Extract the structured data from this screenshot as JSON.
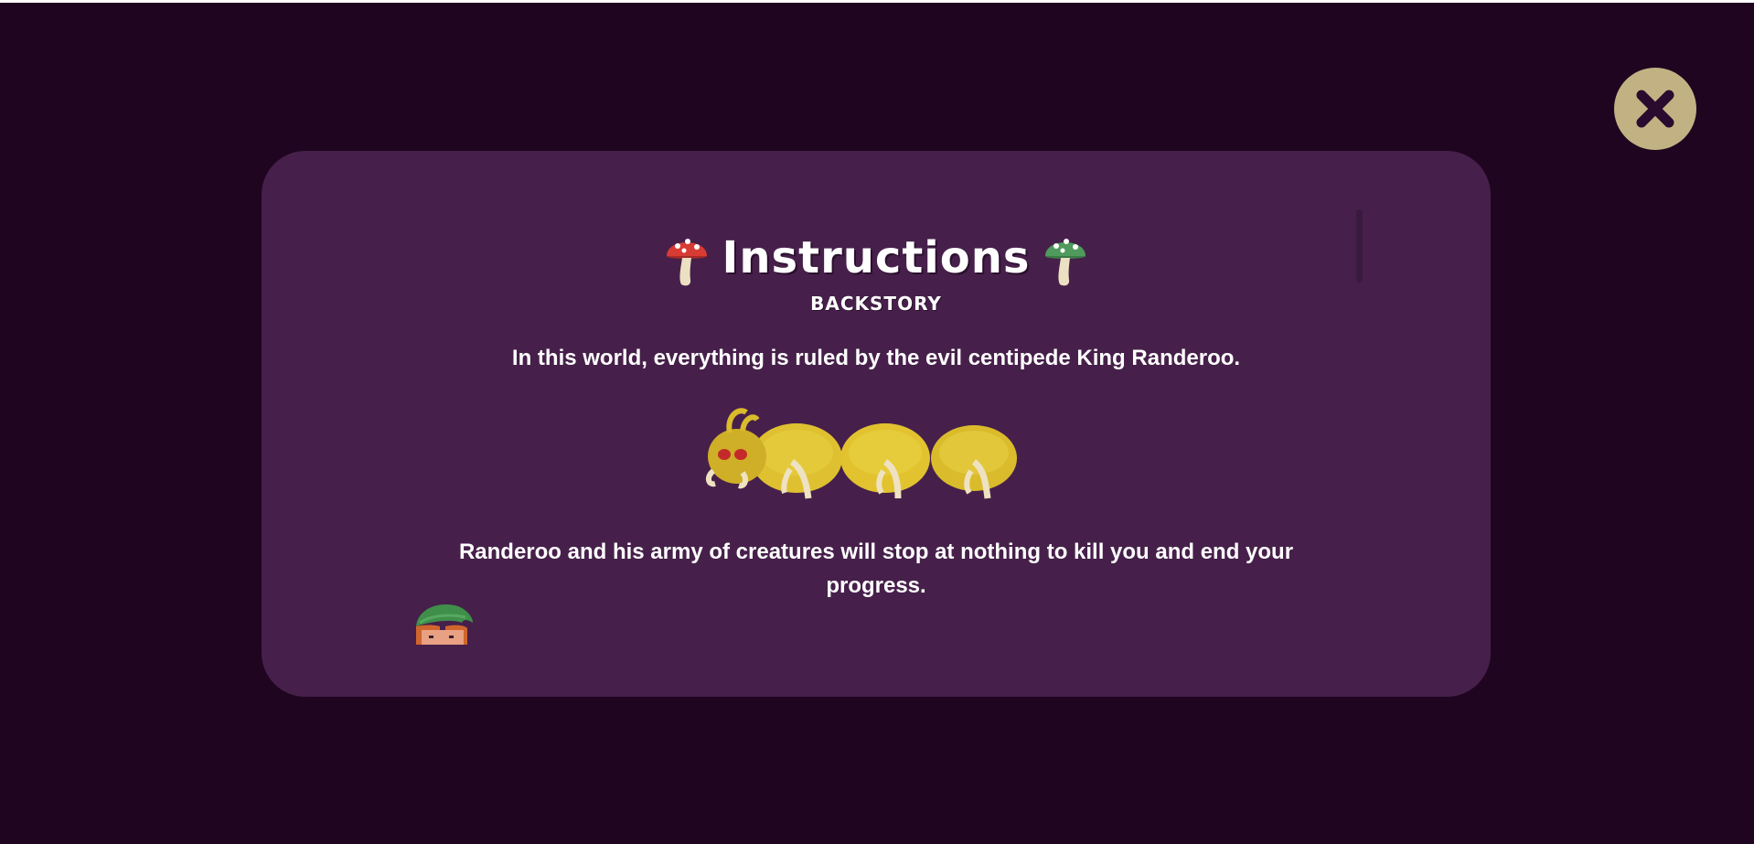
{
  "modal": {
    "title": "Instructions",
    "subtitle": "BACKSTORY",
    "paragraph_1": "In this world, everything is ruled by the evil centipede King Randeroo.",
    "paragraph_2": "Randeroo and his army of creatures will stop at nothing to kill you and end your progress."
  },
  "icons": {
    "left_title_icon": "red-mushroom-icon",
    "right_title_icon": "green-mushroom-icon",
    "close": "close-icon",
    "centipede_image": "yellow-centipede-king",
    "elf_image": "elf-with-green-hat"
  },
  "colors": {
    "background": "#1f0520",
    "modal": "#46204a",
    "close_button": "#c2b283",
    "text": "#ffffff"
  }
}
